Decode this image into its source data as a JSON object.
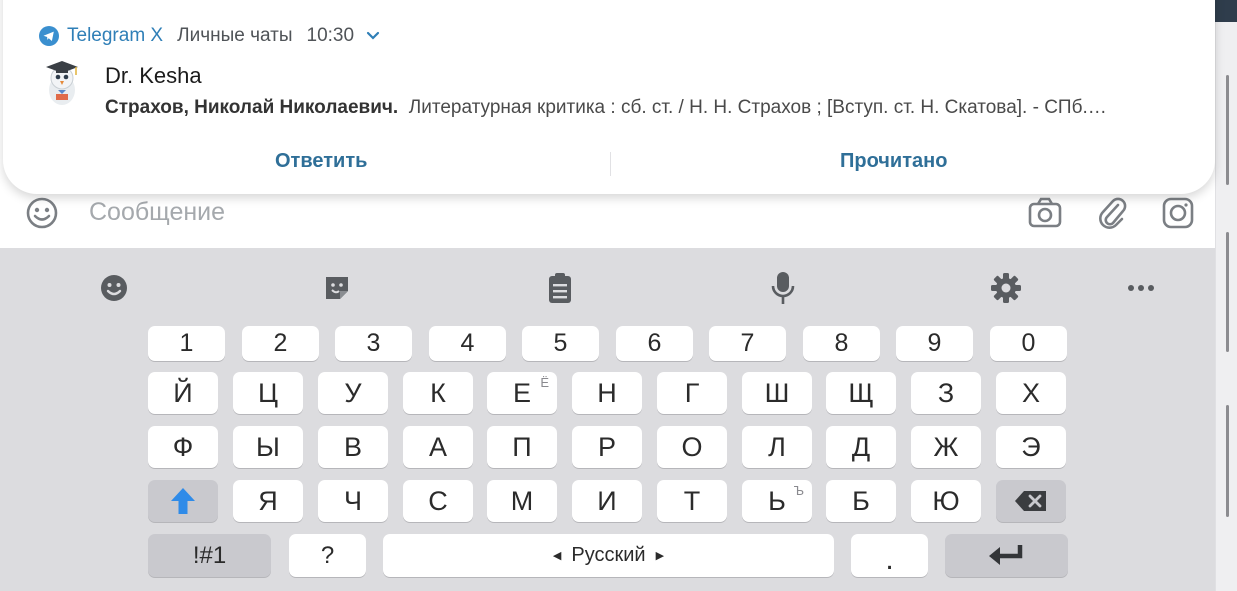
{
  "notification": {
    "app_name": "Telegram X",
    "section": "Личные чаты",
    "time": "10:30",
    "sender": "Dr. Kesha",
    "message_bold": "Страхов, Николай Николаевич.",
    "message_rest": "Литературная критика : сб. ст. / Н. Н. Страхов ;  [Вступ. ст. Н. Скатова]. - СПб.…",
    "actions": {
      "reply": "Ответить",
      "mark_read": "Прочитано"
    }
  },
  "composer": {
    "placeholder": "Сообщение",
    "icons": [
      "emoji-icon",
      "camera-icon",
      "paperclip-icon",
      "instagram-camera-icon"
    ]
  },
  "keyboard": {
    "toolbar_icons": [
      "emoji-face-icon",
      "sticker-icon",
      "clipboard-icon",
      "microphone-icon",
      "settings-gear-icon",
      "more-dots-icon"
    ],
    "number_row": [
      "1",
      "2",
      "3",
      "4",
      "5",
      "6",
      "7",
      "8",
      "9",
      "0"
    ],
    "row1": [
      "Й",
      "Ц",
      "У",
      "К",
      "Е",
      "Н",
      "Г",
      "Ш",
      "Щ",
      "З",
      "Х"
    ],
    "row1_hint_e": "Ё",
    "row2": [
      "Ф",
      "Ы",
      "В",
      "А",
      "П",
      "Р",
      "О",
      "Л",
      "Д",
      "Ж",
      "Э"
    ],
    "row3": [
      "Я",
      "Ч",
      "С",
      "М",
      "И",
      "Т",
      "Ь",
      "Б",
      "Ю"
    ],
    "row3_hint_soft": "Ъ",
    "symbols_key": "!#1",
    "question_key": "?",
    "space_label": "Русский",
    "period_key": ".",
    "accent_color": "#2f8be8"
  }
}
